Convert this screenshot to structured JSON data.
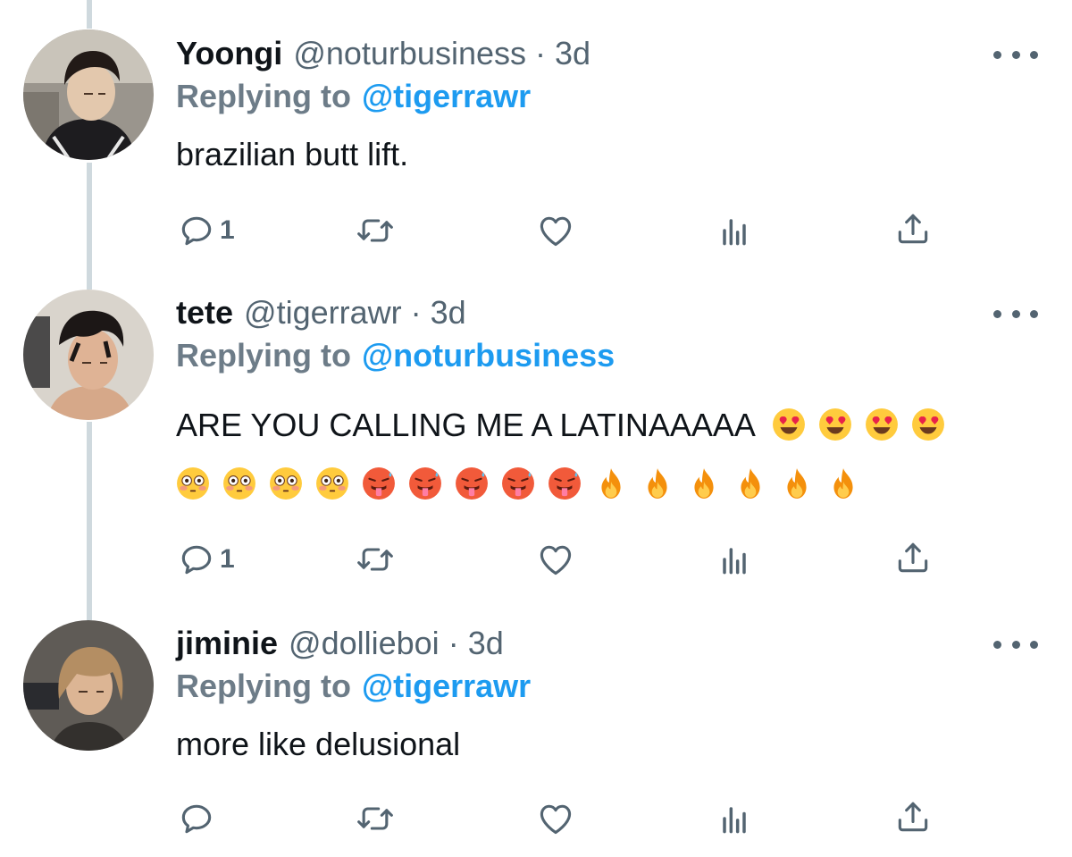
{
  "tweets": [
    {
      "name": "Yoongi",
      "handle": "@noturbusiness",
      "separator": "·",
      "time": "3d",
      "replying_label": "Replying to",
      "replying_to": "@tigerrawr",
      "text": "brazilian butt lift.",
      "reply_count": "1"
    },
    {
      "name": "tete",
      "handle": "@tigerrawr",
      "separator": "·",
      "time": "3d",
      "replying_label": "Replying to",
      "replying_to": "@noturbusiness",
      "text": "ARE YOU CALLING ME A LATINAAAAA",
      "emoji_line1": [
        "heart-eyes-emoji",
        "heart-eyes-emoji",
        "heart-eyes-emoji",
        "heart-eyes-emoji"
      ],
      "emoji_line2": [
        "flushed-emoji",
        "flushed-emoji",
        "flushed-emoji",
        "flushed-emoji",
        "hot-face-emoji",
        "hot-face-emoji",
        "hot-face-emoji",
        "hot-face-emoji",
        "hot-face-emoji",
        "fire-emoji",
        "fire-emoji",
        "fire-emoji",
        "fire-emoji",
        "fire-emoji",
        "fire-emoji"
      ],
      "reply_count": "1"
    },
    {
      "name": "jiminie",
      "handle": "@dollieboi",
      "separator": "·",
      "time": "3d",
      "replying_label": "Replying to",
      "replying_to": "@tigerrawr",
      "text": "more like delusional",
      "reply_count": ""
    }
  ],
  "action_icons": [
    "reply-icon",
    "retweet-icon",
    "like-icon",
    "analytics-icon",
    "share-icon"
  ],
  "colors": {
    "link": "#1d9bf0",
    "secondary": "#536471",
    "thread_line": "#cfd9de",
    "text": "#0f1419"
  }
}
